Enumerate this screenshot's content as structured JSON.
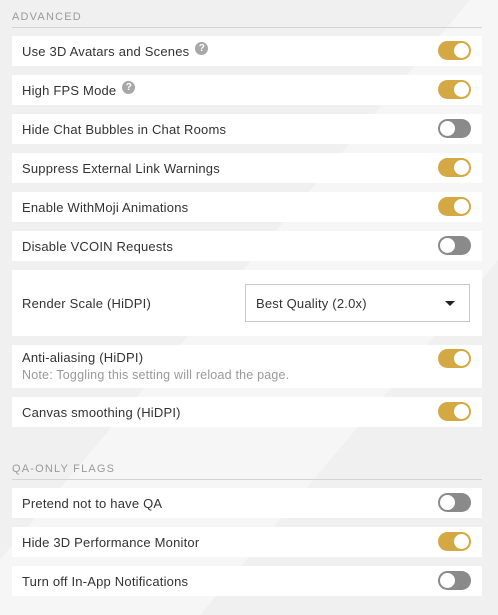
{
  "sections": {
    "advanced": {
      "title": "ADVANCED",
      "rows": [
        {
          "label": "Use 3D Avatars and Scenes",
          "help": "?",
          "enabled": true
        },
        {
          "label": "High FPS Mode",
          "help": "?",
          "enabled": true
        },
        {
          "label": "Hide Chat Bubbles in Chat Rooms",
          "enabled": false
        },
        {
          "label": "Suppress External Link Warnings",
          "enabled": true
        },
        {
          "label": "Enable WithMoji Animations",
          "enabled": true
        },
        {
          "label": "Disable VCOIN Requests",
          "enabled": false
        }
      ],
      "render_scale": {
        "label": "Render Scale (HiDPI)",
        "selected": "Best Quality (2.0x)"
      },
      "anti_aliasing": {
        "label": "Anti-aliasing (HiDPI)",
        "note": "Note: Toggling this setting will reload the page.",
        "enabled": true
      },
      "canvas_smoothing": {
        "label": "Canvas smoothing (HiDPI)",
        "enabled": true
      }
    },
    "qa": {
      "title": "QA-ONLY FLAGS",
      "rows": [
        {
          "label": "Pretend not to have QA",
          "enabled": false
        },
        {
          "label": "Hide 3D Performance Monitor",
          "enabled": true
        },
        {
          "label": "Turn off In-App Notifications",
          "enabled": false
        }
      ]
    }
  },
  "colors": {
    "toggle_on": "#d4a843",
    "toggle_off": "#8a8a8a",
    "background": "#f0f0f0"
  }
}
